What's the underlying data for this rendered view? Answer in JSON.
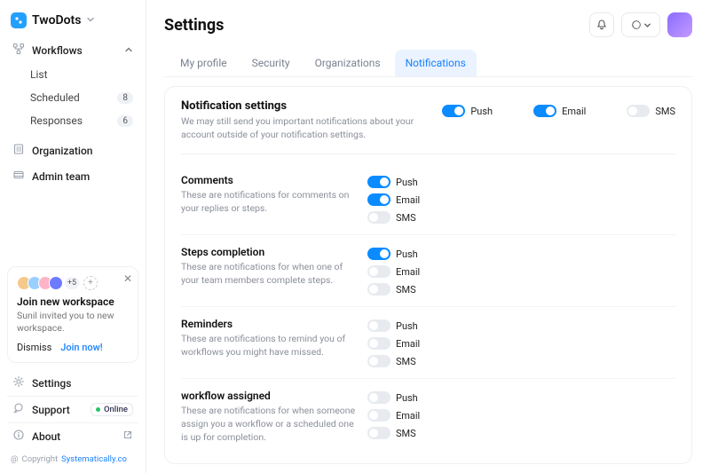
{
  "brand": {
    "name": "TwoDots"
  },
  "sidebar": {
    "workflows_label": "Workflows",
    "items": [
      {
        "label": "List"
      },
      {
        "label": "Scheduled",
        "badge": "8"
      },
      {
        "label": "Responses",
        "badge": "6"
      }
    ],
    "organization_label": "Organization",
    "admin_team_label": "Admin team"
  },
  "workspace_card": {
    "more_count": "+5",
    "title": "Join new workspace",
    "desc": "Sunil invited you to new workspace.",
    "dismiss": "Dismiss",
    "join": "Join now!"
  },
  "bottom": {
    "settings": "Settings",
    "support": "Support",
    "support_status": "Online",
    "about": "About"
  },
  "copyright": {
    "prefix": "Copyright",
    "link": "Systematically.co"
  },
  "page": {
    "title": "Settings"
  },
  "tabs": {
    "my_profile": "My profile",
    "security": "Security",
    "organizations": "Organizations",
    "notifications": "Notifications"
  },
  "notif": {
    "title": "Notification settings",
    "desc": "We may still send you important notifications about your account outside of your notification settings.",
    "channels": {
      "push": "Push",
      "email": "Email",
      "sms": "SMS"
    },
    "master": {
      "push": true,
      "email": true,
      "sms": false
    },
    "groups": [
      {
        "title": "Comments",
        "desc": "These are notifications for comments on your replies or steps.",
        "push": true,
        "email": true,
        "sms": false
      },
      {
        "title": "Steps completion",
        "desc": "These are notifications for when one of your team members complete steps.",
        "push": true,
        "email": false,
        "sms": false
      },
      {
        "title": "Reminders",
        "desc": "These are notifications to remind you of workflows you might have missed.",
        "push": false,
        "email": false,
        "sms": false
      },
      {
        "title": "workflow assigned",
        "desc": "These are notifications for when someone assign you a workflow or a scheduled one is up for completion.",
        "push": false,
        "email": false,
        "sms": false
      }
    ]
  }
}
